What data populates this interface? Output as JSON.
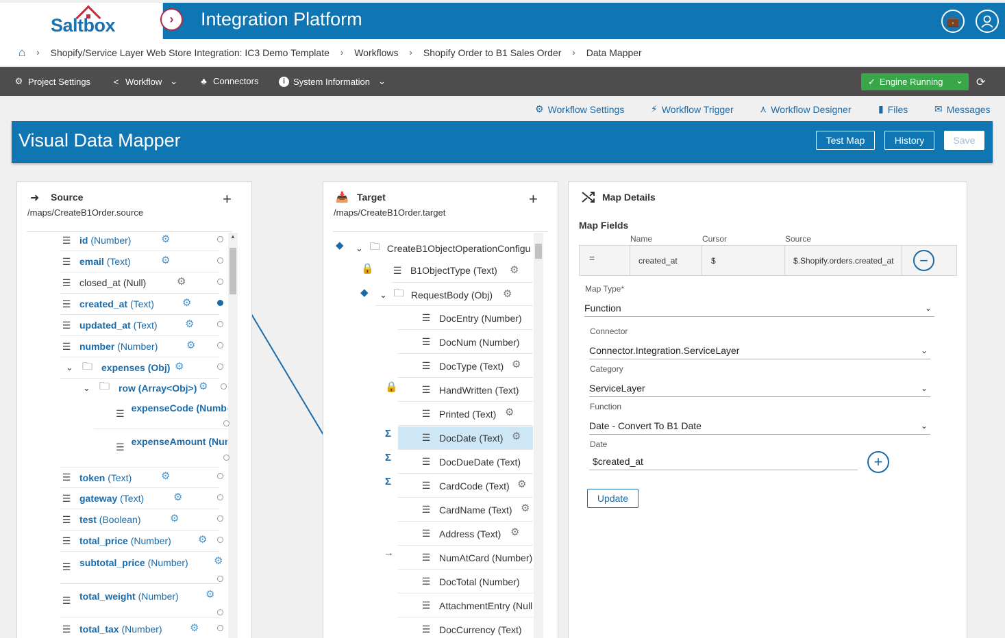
{
  "header": {
    "logo_text": "Saltbox",
    "title": "Integration Platform"
  },
  "breadcrumb": [
    "Shopify/Service Layer Web Store Integration: IC3 Demo Template",
    "Workflows",
    "Shopify Order to B1 Sales Order",
    "Data Mapper"
  ],
  "toolbar": {
    "project_settings": "Project Settings",
    "workflow": "Workflow",
    "connectors": "Connectors",
    "system_information": "System Information",
    "engine": "Engine Running"
  },
  "subnav": {
    "workflow_settings": "Workflow Settings",
    "workflow_trigger": "Workflow Trigger",
    "workflow_designer": "Workflow Designer",
    "files": "Files",
    "messages": "Messages"
  },
  "mapper": {
    "title": "Visual Data Mapper",
    "test_map": "Test Map",
    "history": "History",
    "save": "Save"
  },
  "source": {
    "title": "Source",
    "path": "/maps/CreateB1Order.source",
    "rows": [
      {
        "name": "id",
        "type": "(Number)"
      },
      {
        "name": "email",
        "type": "(Text)"
      },
      {
        "name": "closed_at",
        "type": "(Null)"
      },
      {
        "name": "created_at",
        "type": "(Text)"
      },
      {
        "name": "updated_at",
        "type": "(Text)"
      },
      {
        "name": "number",
        "type": "(Number)"
      },
      {
        "name": "expenses",
        "type": "(Obj)"
      },
      {
        "name": "row",
        "type": "(Array<Obj>)"
      },
      {
        "name": "expenseCode",
        "type": "(Numbe"
      },
      {
        "name": "expenseAmount",
        "type": "(Nur"
      },
      {
        "name": "token",
        "type": "(Text)"
      },
      {
        "name": "gateway",
        "type": "(Text)"
      },
      {
        "name": "test",
        "type": "(Boolean)"
      },
      {
        "name": "total_price",
        "type": "(Number)"
      },
      {
        "name": "subtotal_price",
        "type": "(Number)"
      },
      {
        "name": "total_weight",
        "type": "(Number)"
      },
      {
        "name": "total_tax",
        "type": "(Number)"
      }
    ]
  },
  "target": {
    "title": "Target",
    "path": "/maps/CreateB1Order.target",
    "rows": [
      "CreateB1ObjectOperationConfigu",
      "B1ObjectType (Text)",
      "RequestBody (Obj)",
      "DocEntry (Number)",
      "DocNum (Number)",
      "DocType (Text)",
      "HandWritten (Text)",
      "Printed (Text)",
      "DocDate (Text)",
      "DocDueDate (Text)",
      "CardCode (Text)",
      "CardName (Text)",
      "Address (Text)",
      "NumAtCard (Number)",
      "DocTotal (Number)",
      "AttachmentEntry (Null",
      "DocCurrency (Text)"
    ]
  },
  "details": {
    "title": "Map Details",
    "map_fields": "Map Fields",
    "columns": {
      "name": "Name",
      "cursor": "Cursor",
      "source": "Source"
    },
    "field": {
      "op": "=",
      "name": "created_at",
      "cursor": "$",
      "source": "$.Shopify.orders.created_at"
    },
    "map_type_label": "Map Type*",
    "map_type": "Function",
    "connector_label": "Connector",
    "connector": "Connector.Integration.ServiceLayer",
    "category_label": "Category",
    "category": "ServiceLayer",
    "function_label": "Function",
    "function": "Date - Convert To B1 Date",
    "date_label": "Date",
    "date": "$created_at",
    "update": "Update"
  },
  "colors": {
    "primary": "#0f75b3",
    "engine": "#3aa64a",
    "toolbar": "#4d4d4d",
    "accent": "#b02a45"
  }
}
